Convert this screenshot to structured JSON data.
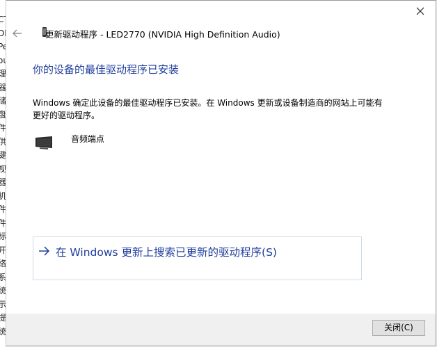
{
  "backdrop": {
    "fragments": [
      "CT",
      "DE",
      "Pe",
      "ou",
      "理",
      "器",
      "储",
      "盘",
      "件",
      "供",
      "键",
      "视",
      "器",
      "机",
      "件",
      "件",
      "标",
      "开",
      "络",
      "系",
      "统",
      "示",
      "提",
      "统"
    ]
  },
  "dialog": {
    "title": "更新驱动程序 - LED2770 (NVIDIA High Definition Audio)",
    "heading": "你的设备的最佳驱动程序已安装",
    "description": "Windows 确定此设备的最佳驱动程序已安装。在 Windows 更新或设备制造商的网站上可能有更好的驱动程序。",
    "device_label": "音频端点",
    "search_link": "在 Windows 更新上搜索已更新的驱动程序(S)",
    "close_button": "关闭(C)"
  },
  "colors": {
    "accent": "#1f3d9c",
    "content_bg": "#ffffff",
    "footer_bg": "#f0f0f0"
  },
  "icons": {
    "close": "close-icon",
    "back": "back-arrow-icon",
    "device": "device-icon",
    "monitor": "monitor-icon",
    "link_arrow": "arrow-right-icon"
  }
}
